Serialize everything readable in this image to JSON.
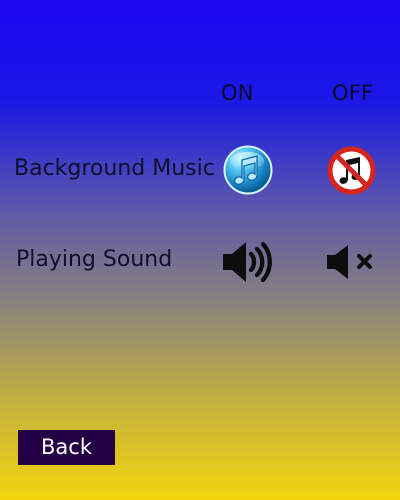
{
  "header": {
    "on_label": "ON",
    "off_label": "OFF"
  },
  "settings": {
    "background_music": {
      "label": "Background Music",
      "on_icon": "music-note-icon",
      "off_icon": "music-off-icon"
    },
    "playing_sound": {
      "label": "Playing Sound",
      "on_icon": "speaker-on-icon",
      "off_icon": "speaker-mute-icon"
    }
  },
  "footer": {
    "back_label": "Back"
  },
  "colors": {
    "background_top": "#1b06f2",
    "background_bottom": "#f3d50e",
    "back_button": "#240044",
    "off_ring": "#d8241f",
    "on_button": "#49b8e8"
  }
}
